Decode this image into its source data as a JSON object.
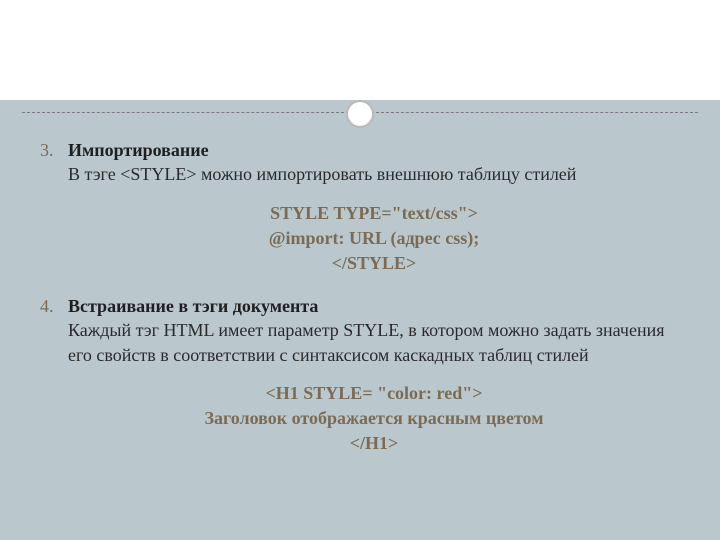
{
  "list": {
    "item3": {
      "heading": "Импортирование",
      "desc_prefix": "В тэге ",
      "desc_tag": "<STYLE>",
      "desc_suffix": " можно импортировать внешнюю таблицу стилей",
      "code_l1": "STYLE TYPE=\"text/css\">",
      "code_l2": "@import: URL (адрес css);",
      "code_l3": "</STYLE>"
    },
    "item4": {
      "heading": "Встраивание в тэги документа",
      "desc": "Каждый тэг HTML имеет параметр STYLE, в котором можно задать значения его свойств в соответствии с синтаксисом каскадных таблиц стилей",
      "code_l1": "<H1 STYLE= \"color: red\">",
      "code_l2": "Заголовок отображается красным цветом",
      "code_l3": "</H1>"
    }
  }
}
